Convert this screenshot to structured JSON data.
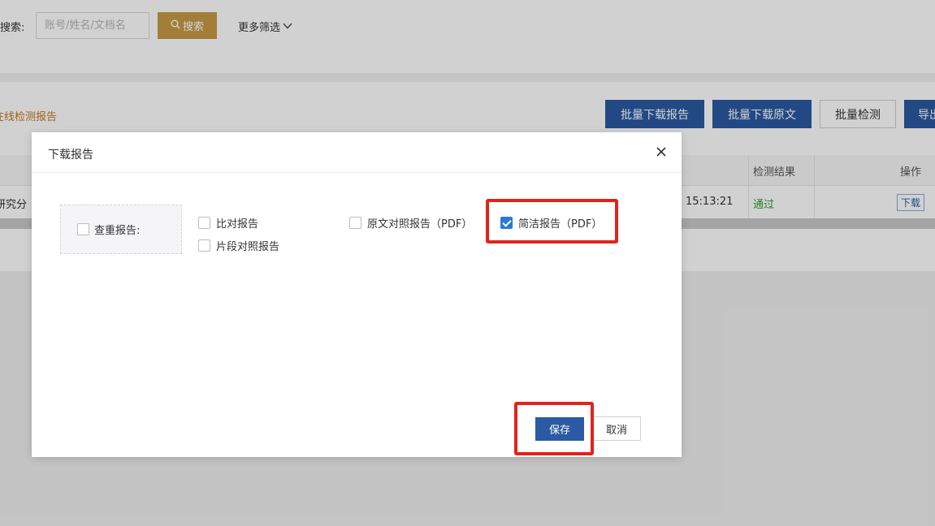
{
  "search": {
    "label": "搜索:",
    "placeholder": "账号/姓名/文档名",
    "button_label": "搜索",
    "more_filter_label": "更多筛选"
  },
  "tab": {
    "label": "在线检测报告"
  },
  "toolbar": {
    "batch_download_report": "批量下载报告",
    "batch_download_original": "批量下载原文",
    "batch_check": "批量检测",
    "export": "导出"
  },
  "table": {
    "headers": {
      "check_result": "检测结果",
      "operation": "操作"
    },
    "rows": [
      {
        "title_fragment": "研究分",
        "time": "15:13:21",
        "result": "通过",
        "action": "下载"
      }
    ]
  },
  "modal": {
    "title": "下载报告",
    "group_label": "查重报告:",
    "options": [
      {
        "label": "比对报告",
        "checked": false
      },
      {
        "label": "片段对照报告",
        "checked": false
      },
      {
        "label": "原文对照报告（PDF）",
        "checked": false
      },
      {
        "label": "简洁报告（PDF）",
        "checked": true
      }
    ],
    "save_label": "保存",
    "cancel_label": "取消"
  },
  "colors": {
    "primary": "#2b5aa3",
    "search_button": "#c79a45",
    "highlight": "#e0241b",
    "checkbox_checked": "#2b78d6",
    "pass": "#2e9e2e"
  },
  "icons": {
    "search": "search-icon",
    "chevron": "chevron-down-icon",
    "close": "close-icon",
    "check": "checkmark-icon"
  }
}
